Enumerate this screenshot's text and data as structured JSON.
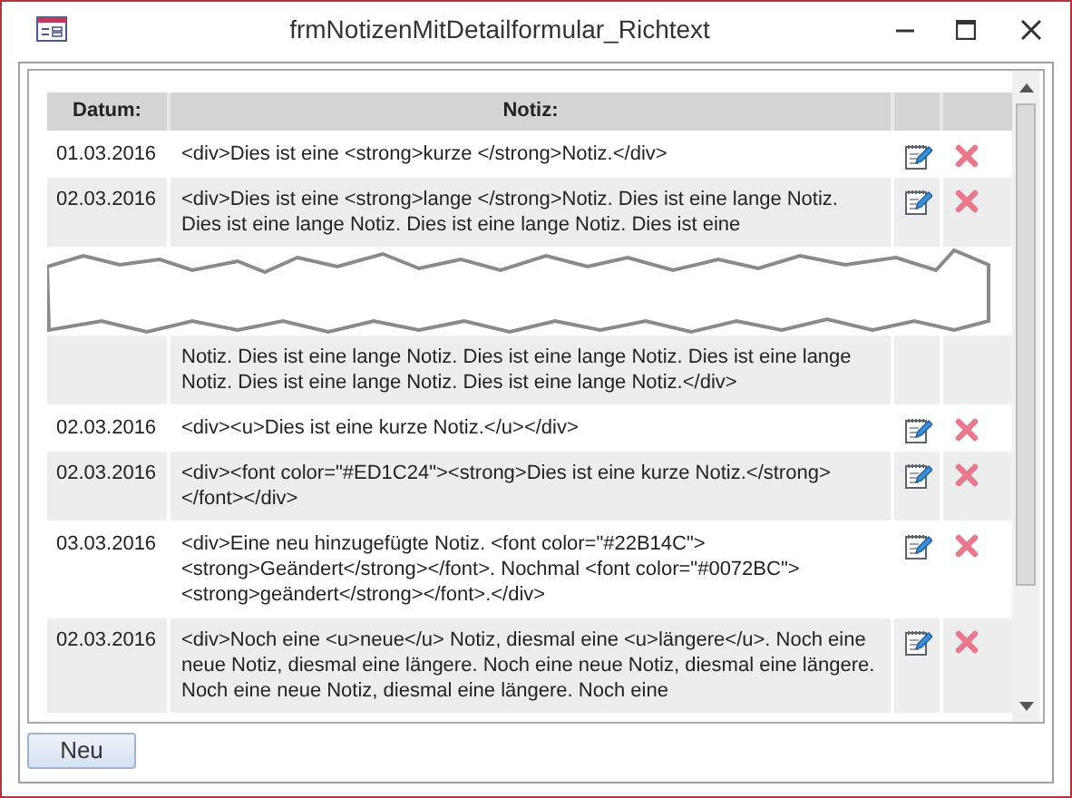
{
  "window": {
    "title": "frmNotizenMitDetailformular_Richtext"
  },
  "table": {
    "columns": [
      "Datum:",
      "Notiz:"
    ],
    "rows": [
      {
        "date": "01.03.2016",
        "note": "<div>Dies ist eine <strong>kurze </strong>Notiz.</div>"
      },
      {
        "date": "02.03.2016",
        "note": "<div>Dies ist eine <strong>lange </strong>Notiz. Dies ist eine lange Notiz. Dies ist eine lange Notiz. Dies ist eine lange Notiz. Dies ist eine",
        "note_continued": "Notiz. Dies ist eine lange Notiz. Dies ist eine lange Notiz. Dies ist eine lange Notiz. Dies ist eine lange Notiz. Dies ist eine lange Notiz.</div>"
      },
      {
        "date": "02.03.2016",
        "note": "<div><u>Dies ist eine kurze Notiz.</u></div>"
      },
      {
        "date": "02.03.2016",
        "note": "<div><font color=\"#ED1C24\"><strong>Dies ist eine kurze Notiz.</strong></font></div>"
      },
      {
        "date": "03.03.2016",
        "note": "<div>Eine neu hinzugefügte Notiz. <font color=\"#22B14C\"><strong>Geändert</strong></font>. Nochmal <font color=\"#0072BC\"><strong>geändert</strong></font>.</div>"
      },
      {
        "date": "02.03.2016",
        "note": "<div>Noch eine <u>neue</u> Notiz, diesmal eine <u>längere</u>. Noch eine neue Notiz, diesmal eine längere. Noch eine neue Notiz, diesmal eine längere. Noch eine neue Notiz, diesmal eine längere. Noch eine"
      }
    ]
  },
  "buttons": [
    {
      "label": "Neu"
    }
  ]
}
